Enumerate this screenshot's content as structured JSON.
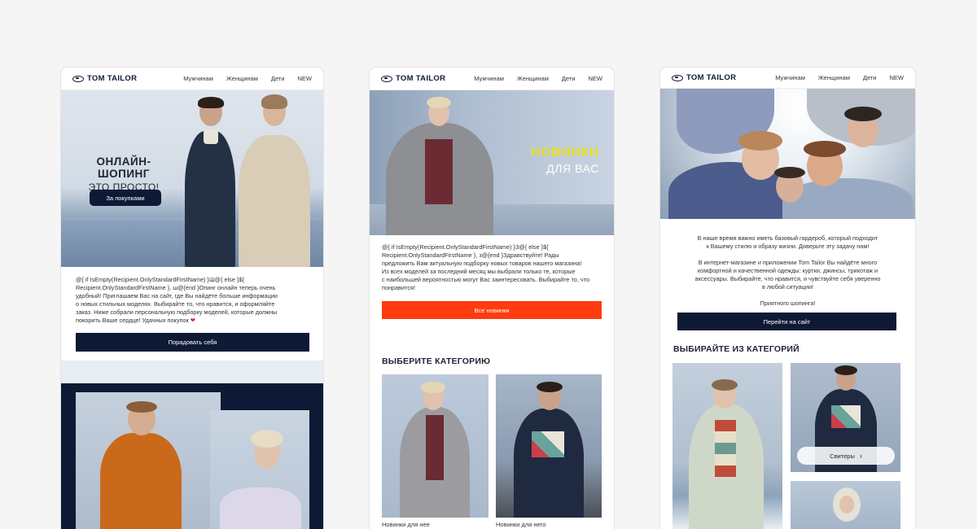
{
  "nav": {
    "brand": "TOM TAILOR",
    "items": [
      "Мужчинам",
      "Женщинам",
      "Дети",
      "NEW"
    ]
  },
  "email1": {
    "hero_title": "ОНЛАЙН-ШОПИНГ",
    "hero_subtitle": "ЭТО ПРОСТО!",
    "hero_button": "За покупками",
    "body_lines": [
      "@{ if IsEmpty(Recipient.OnlyStandardFirstName) }Ш@{ else }${",
      "Recipient.OnlyStandardFirstName }, ш@{end }Опинг онлайн теперь очень",
      "удобный! Приглашаем Вас на сайт, где Вы найдёте больше информации",
      "о новых стильных моделях. Выбирайте то, что нравится, и оформляйте",
      "заказ. Ниже собрали персональную подборку моделей, которые должны",
      "покорить Ваше сердце! Удачных покупок"
    ],
    "cta": "Порадовать себя"
  },
  "email2": {
    "hero_title": "НОВИНКИ",
    "hero_subtitle": "ДЛЯ ВАС",
    "body_lines": [
      "@{ if IsEmpty(Recipient.OnlyStandardFirstName) }З@{ else }${",
      "Recipient.OnlyStandardFirstName }, з@{end }Здравствуйте! Рады",
      "предложить Вам актуальную подборку новых товаров нашего магазина!",
      "Из всех моделей за последний месяц мы выбрали только те, которые",
      "с наибольшей вероятностью могут Вас заинтересовать. Выбирайте то, что",
      "понравится!"
    ],
    "cta": "Все новинки",
    "section_title": "ВЫБЕРИТЕ КАТЕГОРИЮ",
    "categories": [
      "Новинки для нее",
      "Новинки для него"
    ]
  },
  "email3": {
    "para1": [
      "В наше время важно иметь базовый гардероб, который подходит",
      "к Вашему стилю и образу жизни. Доверьте эту задачу нам!"
    ],
    "para2": [
      "В интернет-магазине и приложении Tom Tailor Вы найдёте много",
      "комфортной и качественной одежды: куртки, джинсы, трикотаж и",
      "аксессуары. Выбирайте, что нравится, и чувствуйте себя уверенно",
      "в любой ситуации!"
    ],
    "para3": "Приятного шопинга!",
    "cta": "Перейти на сайт",
    "section_title": "ВЫБИРАЙТЕ ИЗ КАТЕГОРИЙ",
    "category_chip": "Свитеры"
  },
  "colors": {
    "navy": "#0e1a35",
    "orange_cta": "#ff3b0f",
    "sky": "#c9d6e6",
    "yellow_accent": "#e8e020"
  },
  "icons": [
    "heart-icon",
    "chevron-right-icon",
    "brand-logo-icon"
  ]
}
